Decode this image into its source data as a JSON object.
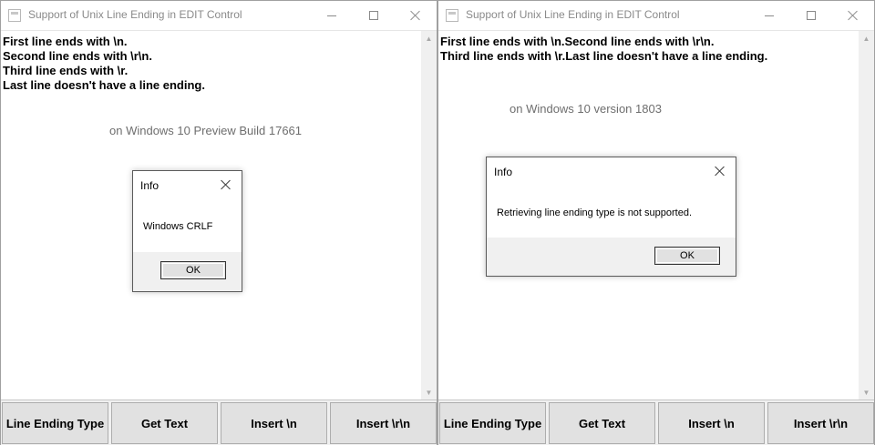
{
  "windows": [
    {
      "title": "Support of Unix Line Ending in EDIT Control",
      "lines": [
        "First line ends with \\n.",
        "Second line ends with \\r\\n.",
        "Third line ends with \\r.",
        "Last line doesn't have a line ending."
      ],
      "caption": "on Windows 10 Preview Build 17661",
      "dialog": {
        "title": "Info",
        "message": "Windows CRLF",
        "ok_label": "OK"
      }
    },
    {
      "title": "Support of Unix Line Ending in EDIT Control",
      "lines": [
        "First line ends with \\n.Second line ends with \\r\\n.",
        "Third line ends with \\r.Last line doesn't have a line ending."
      ],
      "caption": "on Windows 10 version 1803",
      "dialog": {
        "title": "Info",
        "message": "Retrieving line ending type is not supported.",
        "ok_label": "OK"
      }
    }
  ],
  "buttons": [
    "Line Ending Type",
    "Get Text",
    "Insert \\n",
    "Insert \\r\\n"
  ],
  "icons": {
    "minimize": "minimize-icon",
    "maximize": "maximize-icon",
    "close": "close-icon",
    "scroll_up": "scroll-up-arrow-icon",
    "scroll_down": "scroll-down-arrow-icon"
  },
  "colors": {
    "title_text": "#8a8a8a",
    "caption_text": "#6e6e6e",
    "button_face": "#e1e1e1",
    "window_bg": "#f0f0f0"
  }
}
